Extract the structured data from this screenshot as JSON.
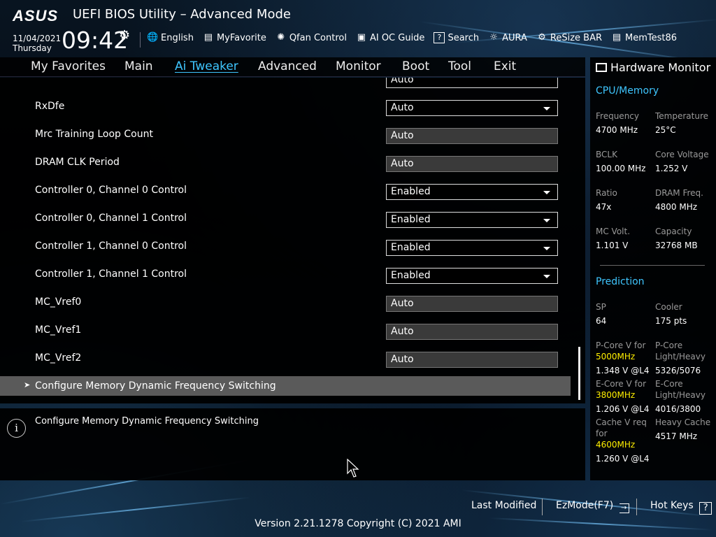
{
  "header": {
    "brand": "ASUS",
    "title": "UEFI BIOS Utility – Advanced Mode",
    "date": "11/04/2021",
    "day": "Thursday",
    "time": "09:42"
  },
  "toolbar": {
    "items": [
      {
        "label": "English",
        "icon": "globe-icon"
      },
      {
        "label": "MyFavorite",
        "icon": "favorite-icon"
      },
      {
        "label": "Qfan Control",
        "icon": "fan-icon"
      },
      {
        "label": "AI OC Guide",
        "icon": "chip-icon"
      },
      {
        "label": "Search",
        "icon": "search-help-icon"
      },
      {
        "label": "AURA",
        "icon": "aura-light-icon"
      },
      {
        "label": "ReSize BAR",
        "icon": "resize-bar-icon"
      },
      {
        "label": "MemTest86",
        "icon": "memory-icon"
      }
    ]
  },
  "menu": {
    "items": [
      "My Favorites",
      "Main",
      "Ai Tweaker",
      "Advanced",
      "Monitor",
      "Boot",
      "Tool",
      "Exit"
    ],
    "active": "Ai Tweaker"
  },
  "settings": {
    "partial_row": {
      "value": "Auto"
    },
    "rows": [
      {
        "label": "RxDfe",
        "value": "Auto",
        "type": "dropdown"
      },
      {
        "label": "Mrc Training Loop Count",
        "value": "Auto",
        "type": "text"
      },
      {
        "label": "DRAM CLK Period",
        "value": "Auto",
        "type": "text"
      },
      {
        "label": "Controller 0, Channel 0 Control",
        "value": "Enabled",
        "type": "dropdown"
      },
      {
        "label": "Controller 0, Channel 1 Control",
        "value": "Enabled",
        "type": "dropdown"
      },
      {
        "label": "Controller 1, Channel 0 Control",
        "value": "Enabled",
        "type": "dropdown"
      },
      {
        "label": "Controller 1, Channel 1 Control",
        "value": "Enabled",
        "type": "dropdown"
      },
      {
        "label": "MC_Vref0",
        "value": "Auto",
        "type": "text"
      },
      {
        "label": "MC_Vref1",
        "value": "Auto",
        "type": "text"
      },
      {
        "label": "MC_Vref2",
        "value": "Auto",
        "type": "text"
      }
    ],
    "submenu": "Configure Memory Dynamic Frequency Switching"
  },
  "help": {
    "text": "Configure Memory Dynamic Frequency Switching"
  },
  "hardware_monitor": {
    "title": "Hardware Monitor",
    "cpu_memory": {
      "section": "CPU/Memory",
      "frequency_label": "Frequency",
      "frequency": "4700 MHz",
      "temperature_label": "Temperature",
      "temperature": "25°C",
      "bclk_label": "BCLK",
      "bclk": "100.00 MHz",
      "core_voltage_label": "Core Voltage",
      "core_voltage": "1.252 V",
      "ratio_label": "Ratio",
      "ratio": "47x",
      "dram_freq_label": "DRAM Freq.",
      "dram_freq": "4800 MHz",
      "mc_volt_label": "MC Volt.",
      "mc_volt": "1.101 V",
      "capacity_label": "Capacity",
      "capacity": "32768 MB"
    },
    "prediction": {
      "section": "Prediction",
      "sp_label": "SP",
      "sp": "64",
      "cooler_label": "Cooler",
      "cooler": "175 pts",
      "pcore_v_label": "P-Core V for",
      "pcore_v_freq": "5000MHz",
      "pcore_v": "1.348 V @L4",
      "pcore_lh_label": "P-Core Light/Heavy",
      "pcore_lh": "5326/5076",
      "ecore_v_label": "E-Core V for",
      "ecore_v_freq": "3800MHz",
      "ecore_v": "1.206 V @L4",
      "ecore_lh_label": "E-Core Light/Heavy",
      "ecore_lh": "4016/3800",
      "cache_v_label": "Cache V req for",
      "cache_v_freq": "4600MHz",
      "cache_v": "1.260 V @L4",
      "heavy_cache_label": "Heavy Cache",
      "heavy_cache": "4517 MHz"
    }
  },
  "footer": {
    "last_modified": "Last Modified",
    "ezmode": "EzMode(F7)",
    "hotkeys": "Hot Keys",
    "hotkeys_icon_text": "?",
    "version": "Version 2.21.1278 Copyright (C) 2021 AMI"
  },
  "colors": {
    "accent": "#3fc6ff",
    "highlight": "#ffef00",
    "panel": "#000000",
    "selected_row": "#5a5a5a"
  }
}
